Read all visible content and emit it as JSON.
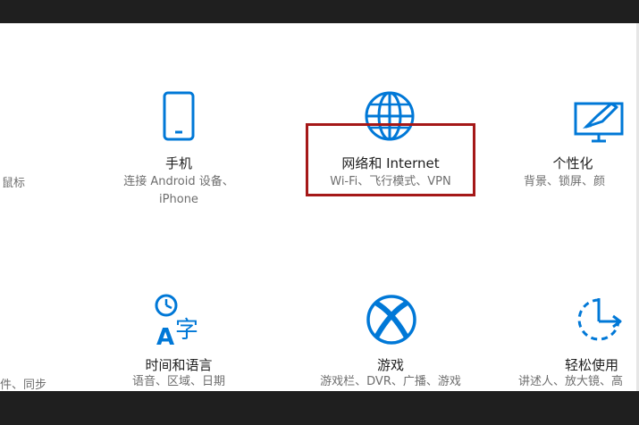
{
  "accent_color": "#0078d7",
  "highlight_color": "#a51818",
  "row1": {
    "left_partial_desc": "鼠标",
    "phone": {
      "name": "手机",
      "desc_line1": "连接 Android 设备、",
      "desc_line2": "iPhone",
      "icon": "phone-icon"
    },
    "network": {
      "name": "网络和 Internet",
      "desc": "Wi-Fi、飞行模式、VPN",
      "icon": "globe-icon"
    },
    "personalization": {
      "name": "个性化",
      "desc": "背景、锁屏、颜",
      "icon": "personalization-icon"
    }
  },
  "row2": {
    "left_partial_desc": "件、同步",
    "time_language": {
      "name": "时间和语言",
      "desc": "语音、区域、日期",
      "icon": "time-language-icon"
    },
    "gaming": {
      "name": "游戏",
      "desc": "游戏栏、DVR、广播、游戏",
      "icon": "xbox-icon"
    },
    "ease_of_access": {
      "name": "轻松使用",
      "desc": "讲述人、放大镜、高",
      "icon": "ease-of-access-icon"
    }
  }
}
